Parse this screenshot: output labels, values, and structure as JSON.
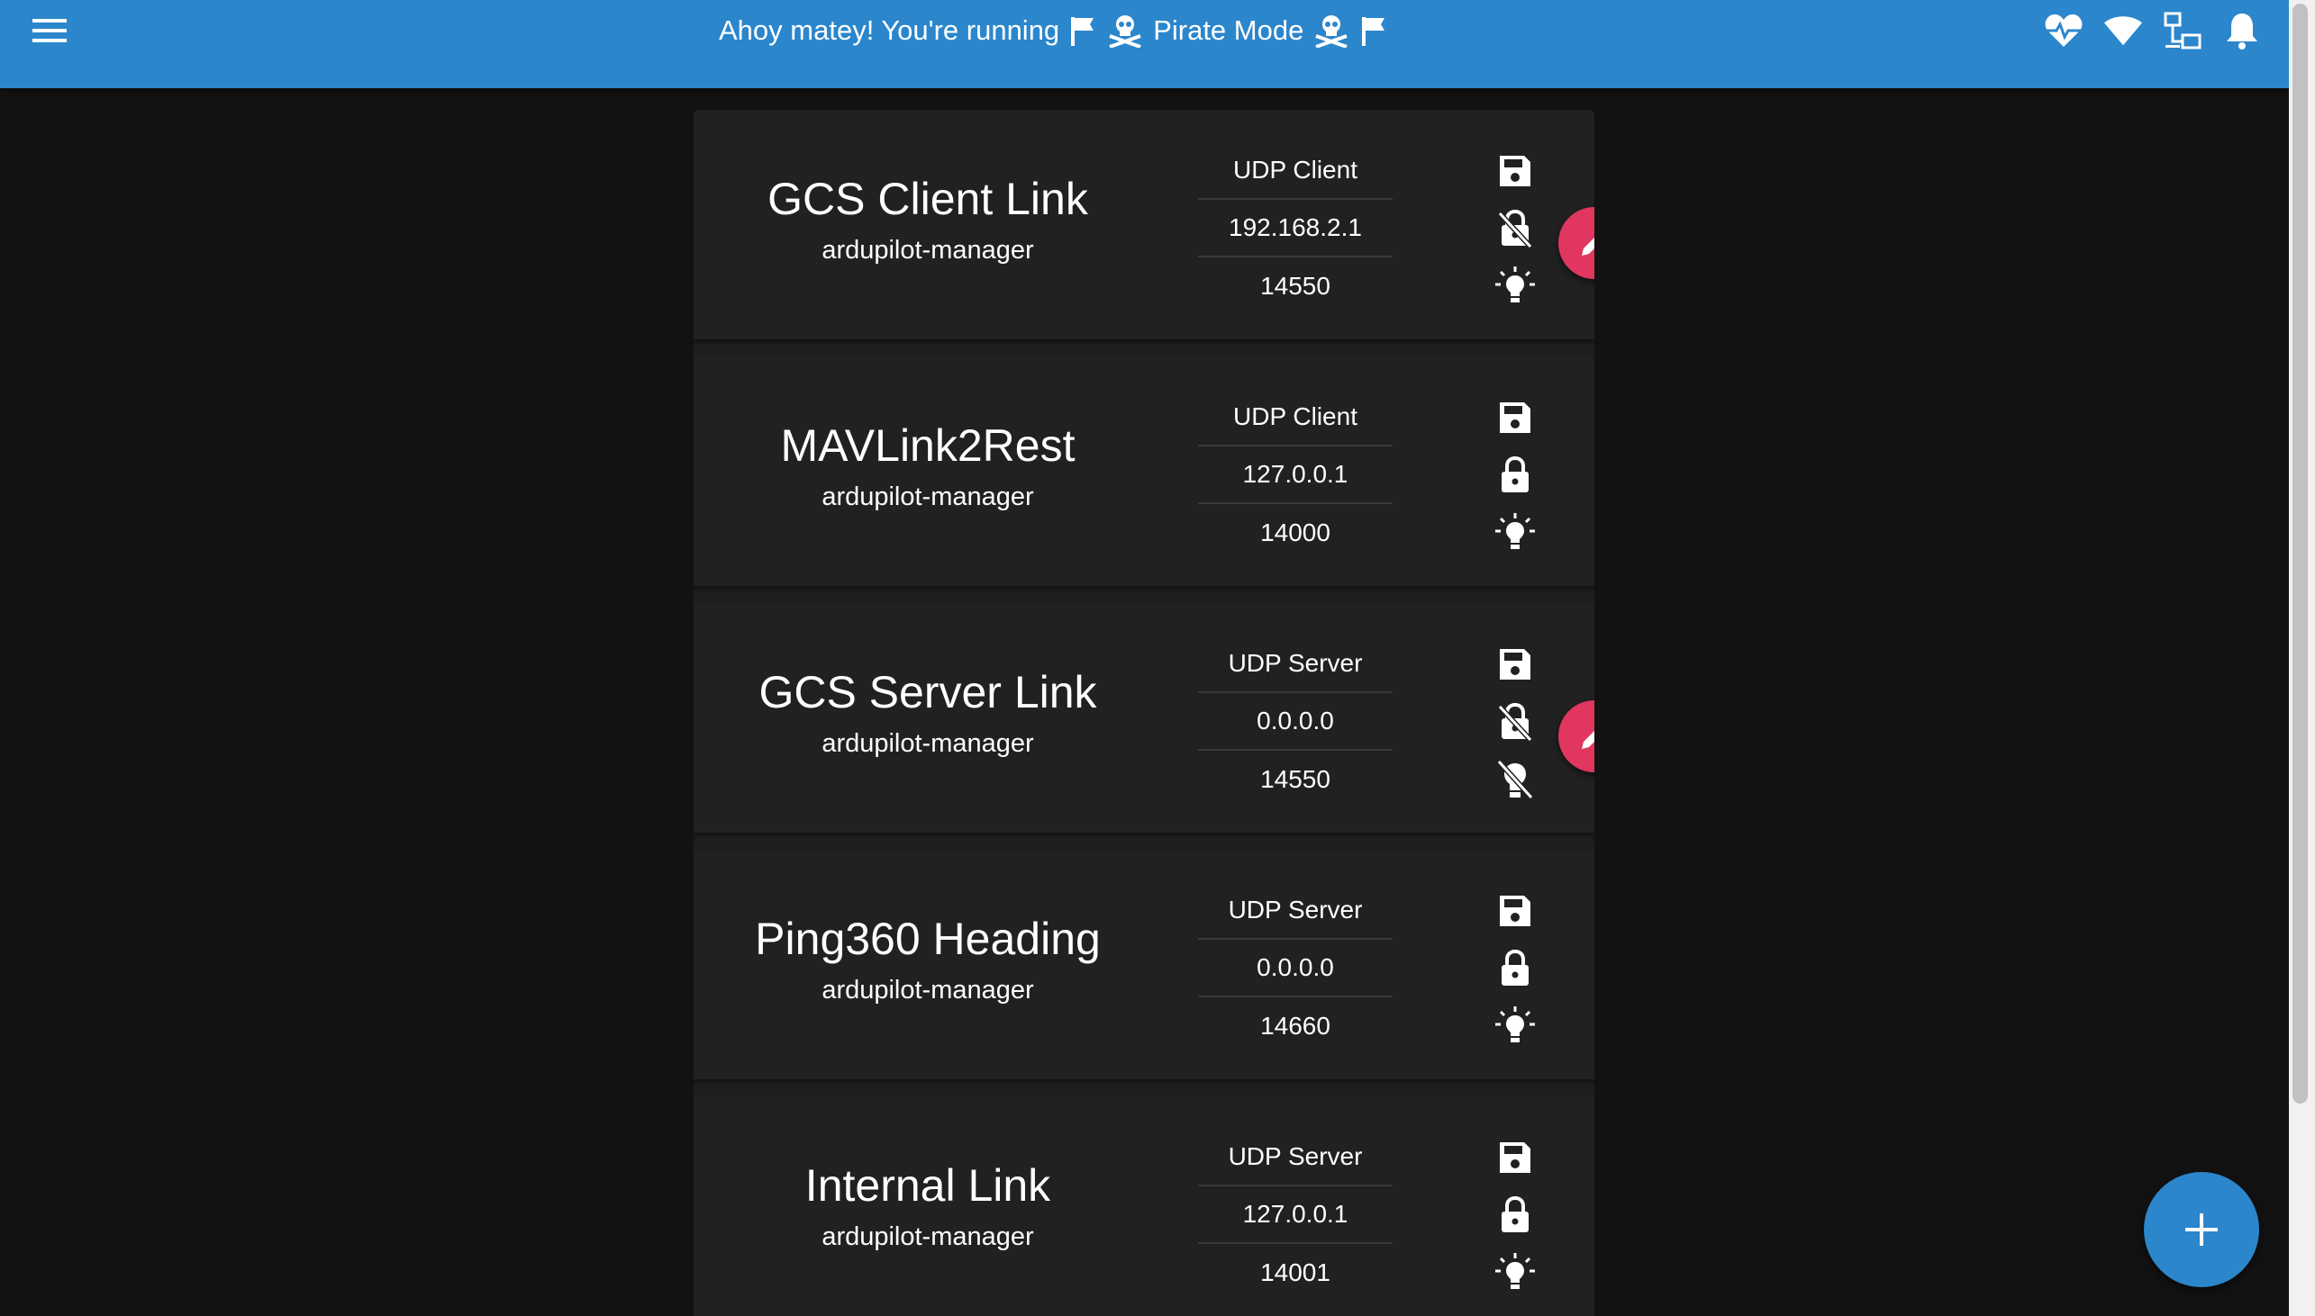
{
  "header": {
    "menu_icon": "hamburger-menu-icon",
    "title_prefix": "Ahoy matey! You're running",
    "title_mode": "Pirate Mode",
    "status_icons": [
      "heart-pulse-icon",
      "wifi-icon",
      "lan-icon",
      "bell-icon"
    ]
  },
  "endpoints": [
    {
      "name": "GCS Client Link",
      "owner": "ardupilot-manager",
      "type": "UDP Client",
      "address": "192.168.2.1",
      "port": "14550",
      "persistent": true,
      "protected": false,
      "enabled": true,
      "editable": true
    },
    {
      "name": "MAVLink2Rest",
      "owner": "ardupilot-manager",
      "type": "UDP Client",
      "address": "127.0.0.1",
      "port": "14000",
      "persistent": true,
      "protected": true,
      "enabled": true,
      "editable": false
    },
    {
      "name": "GCS Server Link",
      "owner": "ardupilot-manager",
      "type": "UDP Server",
      "address": "0.0.0.0",
      "port": "14550",
      "persistent": true,
      "protected": false,
      "enabled": false,
      "editable": true
    },
    {
      "name": "Ping360 Heading",
      "owner": "ardupilot-manager",
      "type": "UDP Server",
      "address": "0.0.0.0",
      "port": "14660",
      "persistent": true,
      "protected": true,
      "enabled": true,
      "editable": false
    },
    {
      "name": "Internal Link",
      "owner": "ardupilot-manager",
      "type": "UDP Server",
      "address": "127.0.0.1",
      "port": "14001",
      "persistent": true,
      "protected": true,
      "enabled": true,
      "editable": false
    }
  ],
  "actions": {
    "add_icon": "plus-icon",
    "edit_icon": "pencil-icon"
  },
  "colors": {
    "app_bar": "#2b86cc",
    "background": "#121212",
    "card": "#212121",
    "edit_fab": "#e0365f",
    "add_fab": "#2b86cc"
  }
}
